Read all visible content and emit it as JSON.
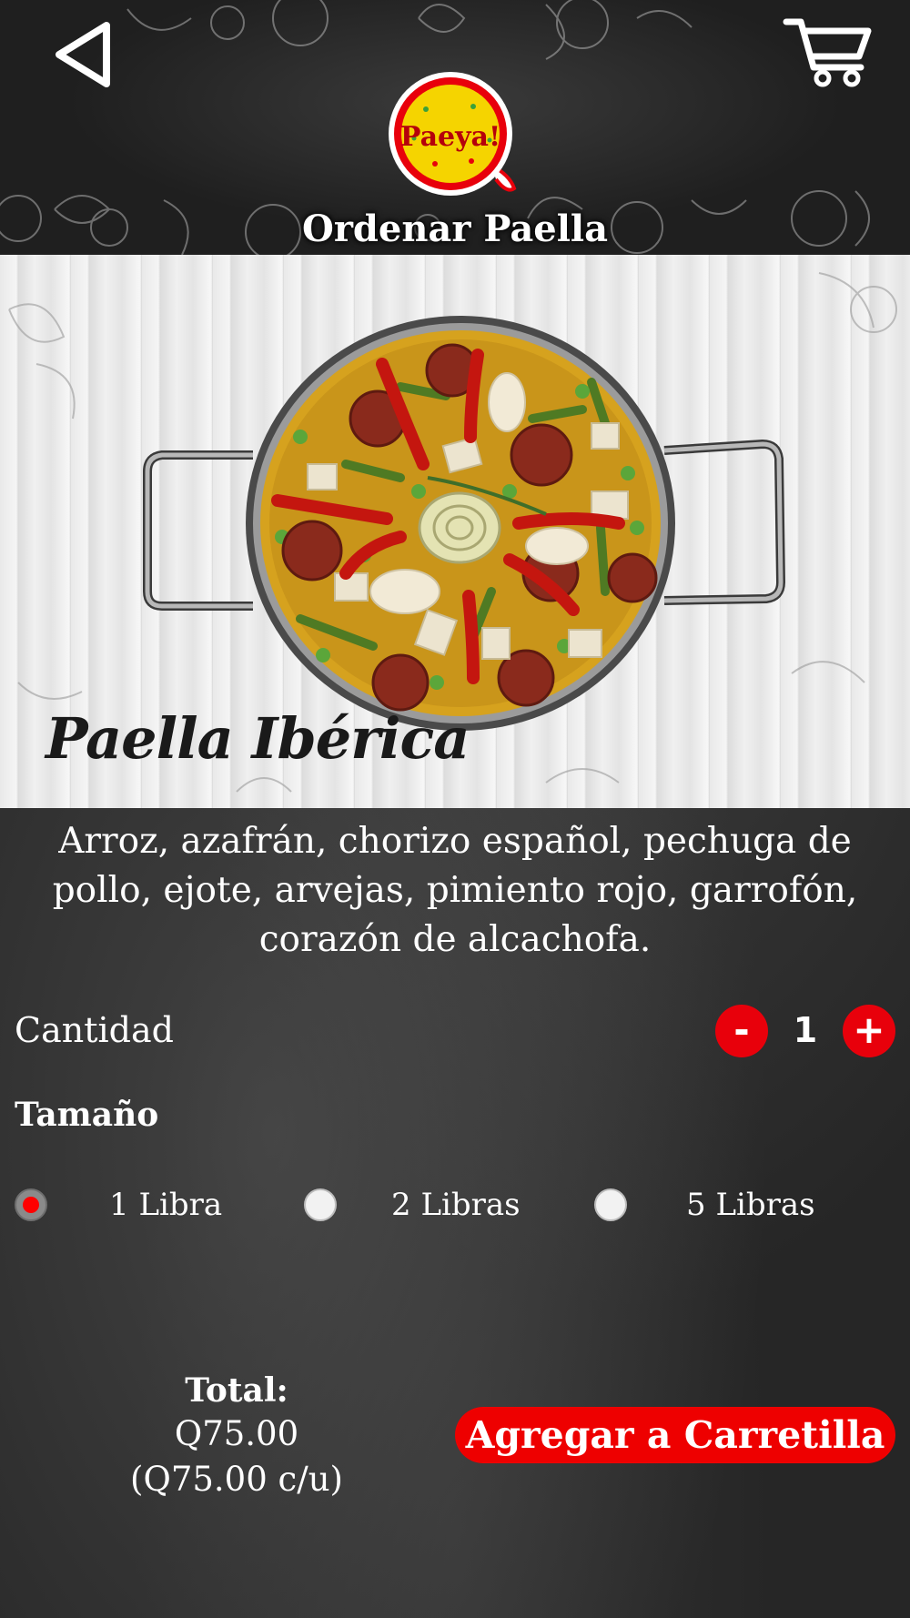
{
  "header": {
    "title": "Ordenar Paella",
    "logo_text": "Paeya!",
    "back_icon": "back-triangle-icon",
    "cart_icon": "shopping-cart-icon"
  },
  "product": {
    "image_title": "Paella Ibérica",
    "description": "Arroz, azafrán, chorizo español, pechuga de pollo, ejote, arvejas, pimiento rojo, garrofón, corazón de alcachofa."
  },
  "quantity": {
    "label": "Cantidad",
    "minus_label": "-",
    "value": "1",
    "plus_label": "+"
  },
  "size": {
    "heading": "Tamaño",
    "options": [
      {
        "label": "1 Libra",
        "selected": true
      },
      {
        "label": "2 Libras",
        "selected": false
      },
      {
        "label": "5 Libras",
        "selected": false
      }
    ]
  },
  "total": {
    "label": "Total:",
    "value": "Q75.00",
    "unit_price": "(Q75.00 c/u)"
  },
  "add_button_label": "Agregar a Carretilla",
  "colors": {
    "accent_red": "#ee0000",
    "chalkboard": "#262626",
    "logo_yellow": "#f5d400"
  }
}
